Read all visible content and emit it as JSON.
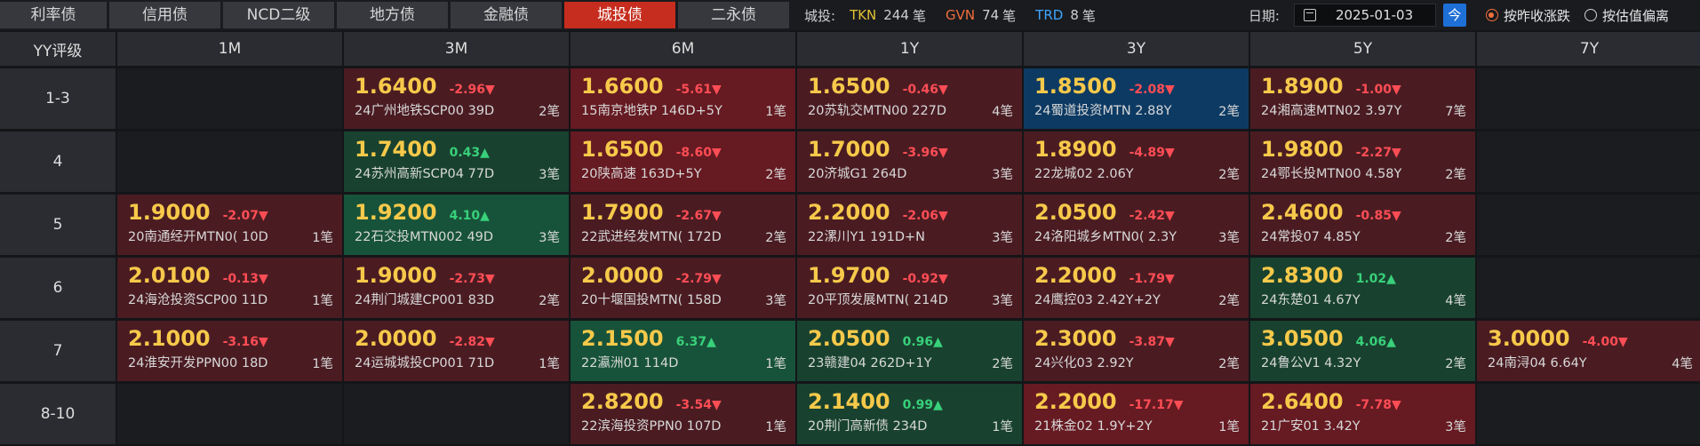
{
  "tabs": [
    {
      "label": "利率债",
      "w": 120
    },
    {
      "label": "信用债",
      "w": 125
    },
    {
      "label": "NCD二级",
      "w": 125
    },
    {
      "label": "地方债",
      "w": 125
    },
    {
      "label": "金融债",
      "w": 125
    },
    {
      "label": "城投债",
      "w": 125,
      "active": true
    },
    {
      "label": "二永债",
      "w": 125
    }
  ],
  "stats": {
    "label": "城投:",
    "tkn_label": "TKN",
    "tkn_count": "244",
    "tkn_unit": "笔",
    "gvn_label": "GVN",
    "gvn_count": "74",
    "gvn_unit": "笔",
    "trd_label": "TRD",
    "trd_count": "8",
    "trd_unit": "笔"
  },
  "date": {
    "label": "日期:",
    "value": "2025-01-03",
    "today": "今"
  },
  "modes": {
    "prev_close": "按昨收涨跌",
    "valuation_dev": "按估值偏离"
  },
  "grid": {
    "corner": "YY评级",
    "tenors": [
      "1M",
      "3M",
      "6M",
      "1Y",
      "3Y",
      "5Y",
      "7Y"
    ],
    "rows": [
      {
        "rating": "1-3",
        "cells": [
          null,
          {
            "y": "1.6400",
            "c": "-2.96",
            "dir": "down",
            "name": "24广州地铁SCP00",
            "term": "39D",
            "n": "2笔",
            "tone": "down"
          },
          {
            "y": "1.6600",
            "c": "-5.61",
            "dir": "down",
            "name": "15南京地铁P",
            "term": "146D+5Y",
            "n": "1笔",
            "tone": "down2"
          },
          {
            "y": "1.6500",
            "c": "-0.46",
            "dir": "down",
            "name": "20苏轨交MTN00",
            "term": "227D",
            "n": "4笔",
            "tone": "down"
          },
          {
            "y": "1.8500",
            "c": "-2.08",
            "dir": "down",
            "name": "24蜀道投资MTN",
            "term": "2.88Y",
            "n": "2笔",
            "tone": "blue"
          },
          {
            "y": "1.8900",
            "c": "-1.00",
            "dir": "down",
            "name": "24湘高速MTN02",
            "term": "3.97Y",
            "n": "7笔",
            "tone": "down"
          },
          null
        ]
      },
      {
        "rating": "4",
        "cells": [
          null,
          {
            "y": "1.7400",
            "c": "0.43",
            "dir": "up",
            "name": "24苏州高新SCP04",
            "term": "77D",
            "n": "3笔",
            "tone": "up"
          },
          {
            "y": "1.6500",
            "c": "-8.60",
            "dir": "down",
            "name": "20陕高速",
            "term": "163D+5Y",
            "n": "2笔",
            "tone": "down2"
          },
          {
            "y": "1.7000",
            "c": "-3.96",
            "dir": "down",
            "name": "20济城G1",
            "term": "264D",
            "n": "3笔",
            "tone": "down"
          },
          {
            "y": "1.8900",
            "c": "-4.89",
            "dir": "down",
            "name": "22龙城02",
            "term": "2.06Y",
            "n": "2笔",
            "tone": "down"
          },
          {
            "y": "1.9800",
            "c": "-2.27",
            "dir": "down",
            "name": "24鄂长投MTN00",
            "term": "4.58Y",
            "n": "2笔",
            "tone": "down"
          },
          null
        ]
      },
      {
        "rating": "5",
        "cells": [
          {
            "y": "1.9000",
            "c": "-2.07",
            "dir": "down",
            "name": "20南通经开MTN0(",
            "term": "10D",
            "n": "1笔",
            "tone": "down"
          },
          {
            "y": "1.9200",
            "c": "4.10",
            "dir": "up",
            "name": "22石交投MTN002",
            "term": "49D",
            "n": "3笔",
            "tone": "up2"
          },
          {
            "y": "1.7900",
            "c": "-2.67",
            "dir": "down",
            "name": "22武进经发MTN(",
            "term": "172D",
            "n": "2笔",
            "tone": "down"
          },
          {
            "y": "2.2000",
            "c": "-2.06",
            "dir": "down",
            "name": "22漯川Y1",
            "term": "191D+N",
            "n": "3笔",
            "tone": "down"
          },
          {
            "y": "2.0500",
            "c": "-2.42",
            "dir": "down",
            "name": "24洛阳城乡MTN0(",
            "term": "2.3Y",
            "n": "3笔",
            "tone": "down"
          },
          {
            "y": "2.4600",
            "c": "-0.85",
            "dir": "down",
            "name": "24常投07",
            "term": "4.85Y",
            "n": "2笔",
            "tone": "down"
          },
          null
        ]
      },
      {
        "rating": "6",
        "cells": [
          {
            "y": "2.0100",
            "c": "-0.13",
            "dir": "down",
            "name": "24海沧投资SCP00",
            "term": "11D",
            "n": "1笔",
            "tone": "down"
          },
          {
            "y": "1.9000",
            "c": "-2.73",
            "dir": "down",
            "name": "24荆门城建CP001",
            "term": "83D",
            "n": "2笔",
            "tone": "down"
          },
          {
            "y": "2.0000",
            "c": "-2.79",
            "dir": "down",
            "name": "20十堰国投MTN(",
            "term": "158D",
            "n": "3笔",
            "tone": "down"
          },
          {
            "y": "1.9700",
            "c": "-0.92",
            "dir": "down",
            "name": "20平顶发展MTN(",
            "term": "214D",
            "n": "3笔",
            "tone": "down"
          },
          {
            "y": "2.2000",
            "c": "-1.79",
            "dir": "down",
            "name": "24鹰控03",
            "term": "2.42Y+2Y",
            "n": "2笔",
            "tone": "down"
          },
          {
            "y": "2.8300",
            "c": "1.02",
            "dir": "up",
            "name": "24东楚01",
            "term": "4.67Y",
            "n": "4笔",
            "tone": "up"
          },
          null
        ]
      },
      {
        "rating": "7",
        "cells": [
          {
            "y": "2.1000",
            "c": "-3.16",
            "dir": "down",
            "name": "24淮安开发PPN00",
            "term": "18D",
            "n": "1笔",
            "tone": "down"
          },
          {
            "y": "2.0000",
            "c": "-2.82",
            "dir": "down",
            "name": "24运城城投CP001",
            "term": "71D",
            "n": "1笔",
            "tone": "down"
          },
          {
            "y": "2.1500",
            "c": "6.37",
            "dir": "up",
            "name": "22瀛洲01",
            "term": "114D",
            "n": "1笔",
            "tone": "up2"
          },
          {
            "y": "2.0500",
            "c": "0.96",
            "dir": "up",
            "name": "23赣建04",
            "term": "262D+1Y",
            "n": "2笔",
            "tone": "up"
          },
          {
            "y": "2.3000",
            "c": "-3.87",
            "dir": "down",
            "name": "24兴化03",
            "term": "2.92Y",
            "n": "2笔",
            "tone": "down"
          },
          {
            "y": "3.0500",
            "c": "4.06",
            "dir": "up",
            "name": "24鲁公V1",
            "term": "4.32Y",
            "n": "2笔",
            "tone": "up"
          },
          {
            "y": "3.0000",
            "c": "-4.00",
            "dir": "down",
            "name": "24南浔04",
            "term": "6.64Y",
            "n": "4笔",
            "tone": "down"
          }
        ]
      },
      {
        "rating": "8-10",
        "cells": [
          null,
          null,
          {
            "y": "2.8200",
            "c": "-3.54",
            "dir": "down",
            "name": "22滨海投资PPN0",
            "term": "107D",
            "n": "1笔",
            "tone": "down"
          },
          {
            "y": "2.1400",
            "c": "0.99",
            "dir": "up",
            "name": "20荆门高新债",
            "term": "234D",
            "n": "1笔",
            "tone": "up"
          },
          {
            "y": "2.2000",
            "c": "-17.17",
            "dir": "down",
            "name": "21株金02",
            "term": "1.9Y+2Y",
            "n": "1笔",
            "tone": "down2"
          },
          {
            "y": "2.6400",
            "c": "-7.78",
            "dir": "down",
            "name": "21广安01",
            "term": "3.42Y",
            "n": "3笔",
            "tone": "down2"
          },
          null
        ]
      }
    ]
  },
  "arrows": {
    "down": "▼",
    "up": "▲"
  }
}
